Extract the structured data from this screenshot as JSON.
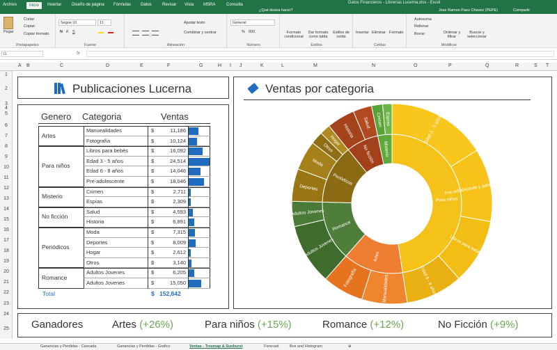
{
  "window": {
    "title": "Datos Financieros - Librerías Lucerna.xlsx - Excel",
    "user": "Jose Ramon Paez Chavez (PEPE)",
    "share": "Compartir",
    "tell_me": "¿Qué desea hacer?"
  },
  "tabs": [
    "Archivo",
    "Inicio",
    "Insertar",
    "Diseño de página",
    "Fórmulas",
    "Datos",
    "Revisar",
    "Vista",
    "MSRA",
    "Consulta"
  ],
  "active_tab": "Inicio",
  "ribbon": {
    "clipboard": {
      "paste": "Pegar",
      "cut": "Cortar",
      "copy": "Copiar",
      "format_painter": "Copiar formato",
      "label": "Portapapeles"
    },
    "font": {
      "name": "Segoe UI",
      "size": "11",
      "label": "Fuente",
      "bold": "N",
      "italic": "K",
      "underline": "S"
    },
    "alignment": {
      "wrap": "Ajustar texto",
      "merge": "Combinar y centrar",
      "label": "Alineación"
    },
    "number": {
      "format": "General",
      "label": "Número",
      "percent": "%",
      "thousands": "000"
    },
    "styles": {
      "conditional": "Formato condicional",
      "table": "Dar formato como tabla",
      "cell_styles": "Estilos de celda",
      "label": "Estilos"
    },
    "cells": {
      "insert": "Insertar",
      "delete": "Eliminar",
      "format": "Formato",
      "label": "Celdas"
    },
    "editing": {
      "autosum": "Autosuma",
      "fill": "Rellenar",
      "clear": "Borrar",
      "sort": "Ordenar y filtrar",
      "find": "Buscar y seleccionar",
      "label": "Modificar"
    }
  },
  "name_box": "I1",
  "formula": "",
  "columns": [
    "A",
    "B",
    "C",
    "D",
    "E",
    "F",
    "G",
    "H",
    "I",
    "J",
    "K",
    "L",
    "M",
    "N",
    "O",
    "P",
    "Q",
    "R",
    "S",
    "T"
  ],
  "rows": [
    "1",
    "2",
    "3",
    "4",
    "5",
    "6",
    "7",
    "8",
    "9",
    "10",
    "11",
    "12",
    "13",
    "14",
    "15",
    "16",
    "17",
    "18",
    "19",
    "20",
    "21",
    "22",
    "23",
    "24",
    "25"
  ],
  "left_title": "Publicaciones Lucerna",
  "right_title": "Ventas por categoria",
  "table_headers": {
    "genre": "Genero",
    "category": "Categoria",
    "sales": "Ventas"
  },
  "groups": [
    {
      "genre": "Artes",
      "items": [
        {
          "cat": "Manuealidades",
          "val": "11,186",
          "n": 11186
        },
        {
          "cat": "Fotografía",
          "val": "10,124",
          "n": 10124
        }
      ]
    },
    {
      "genre": "Para niños",
      "items": [
        {
          "cat": "Libros para bebés",
          "val": "16,092",
          "n": 16092
        },
        {
          "cat": "Edad 3 - 5 años",
          "val": "24,514",
          "n": 24514
        },
        {
          "cat": "Edad 6 - 8 años",
          "val": "14,046",
          "n": 14046
        },
        {
          "cat": "Pre-adolescente",
          "val": "18,046",
          "n": 18046
        }
      ]
    },
    {
      "genre": "Misterio",
      "items": [
        {
          "cat": "Crimen",
          "val": "2,711",
          "n": 2711
        },
        {
          "cat": "Espías",
          "val": "2,309",
          "n": 2309
        }
      ]
    },
    {
      "genre": "No ficción",
      "items": [
        {
          "cat": "Salud",
          "val": "4,593",
          "n": 4593
        },
        {
          "cat": "Historia",
          "val": "6,891",
          "n": 6891
        }
      ]
    },
    {
      "genre": "Periódicos",
      "items": [
        {
          "cat": "Moda",
          "val": "7,315",
          "n": 7315
        },
        {
          "cat": "Deportes",
          "val": "8,009",
          "n": 8009
        },
        {
          "cat": "Hogar",
          "val": "2,612",
          "n": 2612
        },
        {
          "cat": "Otros",
          "val": "3,140",
          "n": 3140
        }
      ]
    },
    {
      "genre": "Romance",
      "items": [
        {
          "cat": "Adultos Jovenes",
          "val": "6,205",
          "n": 6205
        },
        {
          "cat": "Adultos Jovenes",
          "val": "15,050",
          "n": 15050
        }
      ]
    }
  ],
  "currency": "$",
  "total_label": "Total",
  "total_value": "152,842",
  "winners": {
    "label": "Ganadores",
    "items": [
      {
        "name": "Artes",
        "pct": "(+26%)"
      },
      {
        "name": "Para niños",
        "pct": "(+15%)"
      },
      {
        "name": "Romance",
        "pct": "(+12%)"
      },
      {
        "name": "No Ficción",
        "pct": "(+9%)"
      }
    ]
  },
  "sheet_tabs": [
    "Ganancias y Perdidas - Cascada",
    "Ganancias y Perdidas - Grafico",
    "Ventas - Treemap & Sunburst",
    "Forecast",
    "Box and Histogram"
  ],
  "active_sheet": "Ventas - Treemap & Sunburst",
  "chart_data": {
    "type": "sunburst",
    "title": "Ventas por categoria",
    "inner": [
      {
        "name": "Para niños",
        "value": 72698,
        "color": "#f5c21b"
      },
      {
        "name": "Artes",
        "value": 21310,
        "color": "#ed7d31"
      },
      {
        "name": "Romance",
        "value": 21255,
        "color": "#4f7d3a"
      },
      {
        "name": "Periódicos",
        "value": 21076,
        "color": "#8a6a12"
      },
      {
        "name": "No ficción",
        "value": 11484,
        "color": "#a1401a"
      },
      {
        "name": "Misterio",
        "value": 5020,
        "color": "#5fa83b"
      }
    ],
    "outer": [
      {
        "parent": "Para niños",
        "name": "Edad 3 - 5 años",
        "value": 24514,
        "color": "#f8c61d"
      },
      {
        "parent": "Para niños",
        "name": "Pre-adolescente y adolescente",
        "value": 18046,
        "color": "#f7c31a"
      },
      {
        "parent": "Para niños",
        "name": "Libros para bebés",
        "value": 16092,
        "color": "#f2be16"
      },
      {
        "parent": "Para niños",
        "name": "Edad 6 - 8 años",
        "value": 14046,
        "color": "#e8b012"
      },
      {
        "parent": "Artes",
        "name": "Manualidades",
        "value": 11186,
        "color": "#f0852f"
      },
      {
        "parent": "Artes",
        "name": "Fotografía",
        "value": 10124,
        "color": "#e57320"
      },
      {
        "parent": "Romance",
        "name": "Adultos Jovenes",
        "value": 15050,
        "color": "#3f6c2d"
      },
      {
        "parent": "Romance",
        "name": "Adultos Jovenes",
        "value": 6205,
        "color": "#4b7a38"
      },
      {
        "parent": "Periódicos",
        "name": "Deportes",
        "value": 8009,
        "color": "#9a7514"
      },
      {
        "parent": "Periódicos",
        "name": "Moda",
        "value": 7315,
        "color": "#a5801a"
      },
      {
        "parent": "Periódicos",
        "name": "Otros",
        "value": 3140,
        "color": "#8f6d12"
      },
      {
        "parent": "Periódicos",
        "name": "Hogar",
        "value": 2612,
        "color": "#b08a20"
      },
      {
        "parent": "No ficción",
        "name": "Historia",
        "value": 6891,
        "color": "#a3421b"
      },
      {
        "parent": "No ficción",
        "name": "Salud",
        "value": 4593,
        "color": "#b14a20"
      },
      {
        "parent": "Misterio",
        "name": "Crimen",
        "value": 2711,
        "color": "#5aa336"
      },
      {
        "parent": "Misterio",
        "name": "Espías",
        "value": 2309,
        "color": "#6db546"
      }
    ]
  }
}
